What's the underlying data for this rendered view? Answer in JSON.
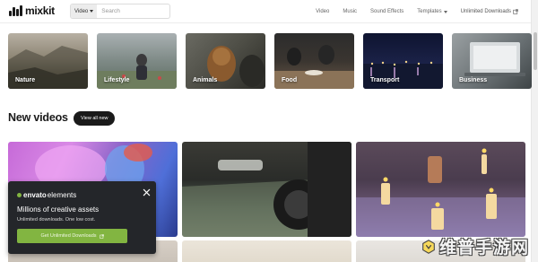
{
  "brand": {
    "logo_text": "mixkit"
  },
  "search": {
    "type_label": "Video",
    "placeholder": "Search"
  },
  "nav": {
    "items": [
      "Video",
      "Music",
      "Sound Effects",
      "Templates",
      "Unlimited Downloads"
    ]
  },
  "categories": [
    "Nature",
    "Lifestyle",
    "Animals",
    "Food",
    "Transport",
    "Business"
  ],
  "new_videos": {
    "title": "New videos",
    "view_all": "View all new"
  },
  "popup": {
    "brand_bold": "envato",
    "brand_light": "elements",
    "title": "Millions of creative assets",
    "subtitle": "Unlimited downloads. One low cost.",
    "cta": "Get Unlimited Downloads"
  },
  "watermark": {
    "text": "维普手游网"
  },
  "colors": {
    "accent_green": "#82b541",
    "popup_bg": "#24262a",
    "pill_bg": "#1a1a1a"
  }
}
